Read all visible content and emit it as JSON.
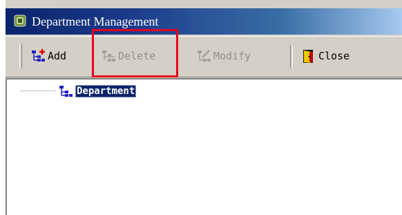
{
  "window": {
    "title": "Department Management",
    "title_icon": "app-icon"
  },
  "toolbar": {
    "add_label": "Add",
    "delete_label": "Delete",
    "modify_label": "Modify",
    "close_label": "Close",
    "delete_enabled": false,
    "modify_enabled": false
  },
  "tree": {
    "root_label": "Department",
    "root_selected": true
  },
  "colors": {
    "titlebar_start": "#0a246a",
    "titlebar_end": "#a6caf0",
    "highlight_box": "#e8001c",
    "selection": "#0a246a"
  }
}
